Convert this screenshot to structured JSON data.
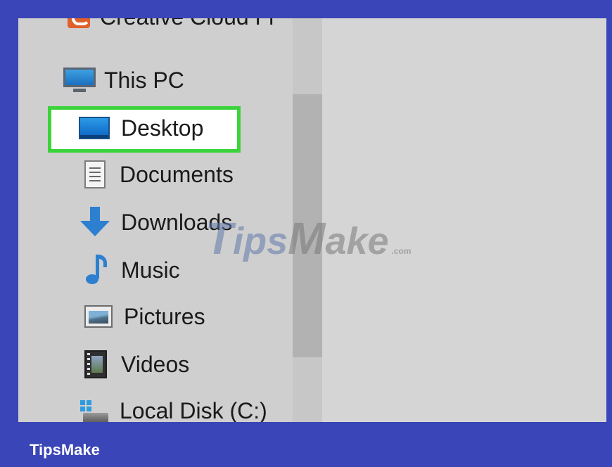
{
  "nav": {
    "items": [
      {
        "label": "Creative Cloud Fi",
        "icon": "creative-cloud-icon"
      },
      {
        "label": "This PC",
        "icon": "monitor-icon"
      },
      {
        "label": "Desktop",
        "icon": "desktop-icon",
        "highlighted": true
      },
      {
        "label": "Documents",
        "icon": "document-icon"
      },
      {
        "label": "Downloads",
        "icon": "download-arrow-icon"
      },
      {
        "label": "Music",
        "icon": "music-note-icon"
      },
      {
        "label": "Pictures",
        "icon": "picture-icon"
      },
      {
        "label": "Videos",
        "icon": "video-icon"
      },
      {
        "label": "Local Disk (C:)",
        "icon": "local-disk-icon"
      }
    ]
  },
  "watermark": {
    "t": "T",
    "ips": "ips",
    "m": "M",
    "ake": "ake",
    "com": ".com"
  },
  "brand": {
    "label": "TipsMake"
  },
  "colors": {
    "frame": "#3a45b7",
    "highlight_border": "#3ad33a",
    "icon_blue": "#2d7fd0"
  }
}
